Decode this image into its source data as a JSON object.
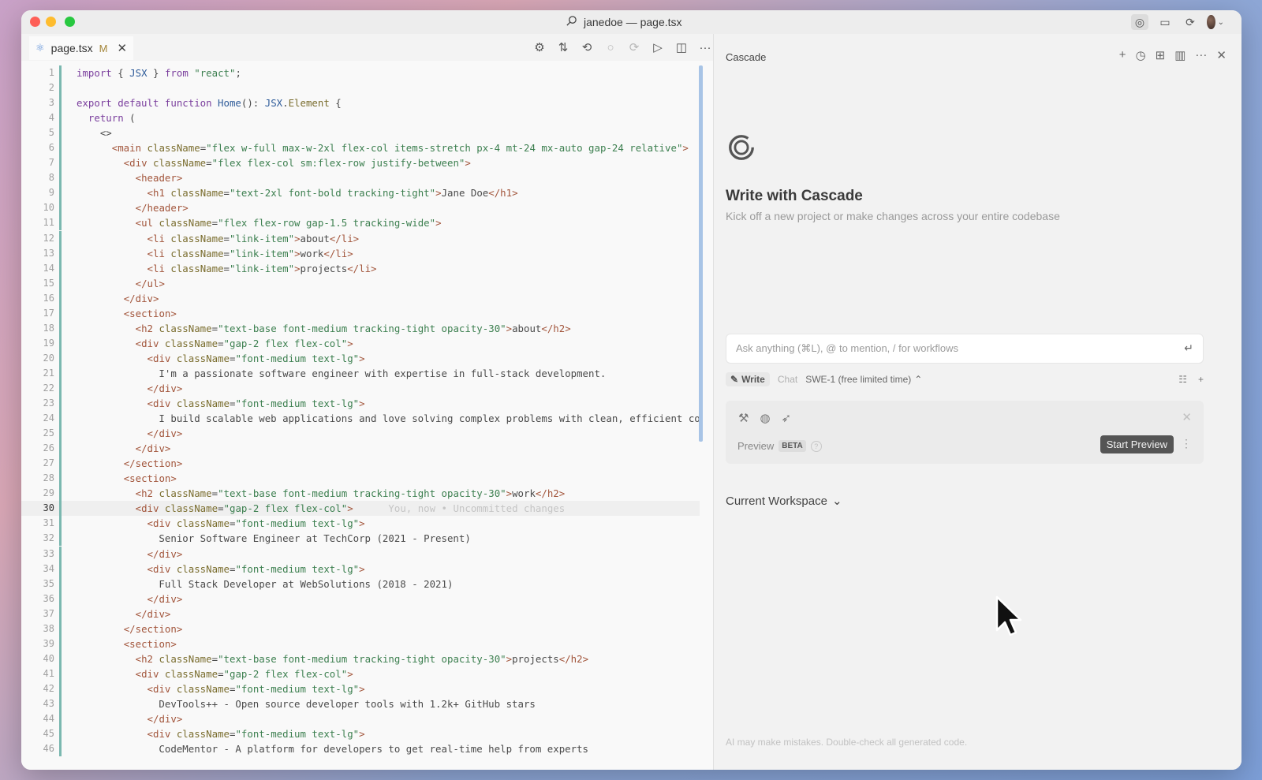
{
  "window": {
    "title": "janedoe — page.tsx"
  },
  "editor": {
    "tab": {
      "filename": "page.tsx",
      "status": "M"
    },
    "current_line": 30,
    "ghost_text": "You, now • Uncommitted changes",
    "lines": [
      [
        [
          "k",
          "import"
        ],
        [
          "t",
          " { "
        ],
        [
          "fn",
          "JSX"
        ],
        [
          "t",
          " } "
        ],
        [
          "k",
          "from"
        ],
        [
          "t",
          " "
        ],
        [
          "s",
          "\"react\""
        ],
        [
          "t",
          ";"
        ]
      ],
      [],
      [
        [
          "k",
          "export default function"
        ],
        [
          "t",
          " "
        ],
        [
          "fn",
          "Home"
        ],
        [
          "t",
          "(): "
        ],
        [
          "fn",
          "JSX"
        ],
        [
          "t",
          "."
        ],
        [
          "at",
          "Element"
        ],
        [
          "t",
          " {"
        ]
      ],
      [
        [
          "t",
          "  "
        ],
        [
          "k",
          "return"
        ],
        [
          "t",
          " ("
        ]
      ],
      [
        [
          "t",
          "    <>"
        ]
      ],
      [
        [
          "t",
          "      "
        ],
        [
          "tg",
          "<main"
        ],
        [
          "t",
          " "
        ],
        [
          "at",
          "className"
        ],
        [
          "t",
          "="
        ],
        [
          "s",
          "\"flex w-full max-w-2xl flex-col items-stretch px-4 mt-24 mx-auto gap-24 relative\""
        ],
        [
          "tg",
          ">"
        ]
      ],
      [
        [
          "t",
          "        "
        ],
        [
          "tg",
          "<div"
        ],
        [
          "t",
          " "
        ],
        [
          "at",
          "className"
        ],
        [
          "t",
          "="
        ],
        [
          "s",
          "\"flex flex-col sm:flex-row justify-between\""
        ],
        [
          "tg",
          ">"
        ]
      ],
      [
        [
          "t",
          "          "
        ],
        [
          "tg",
          "<header>"
        ]
      ],
      [
        [
          "t",
          "            "
        ],
        [
          "tg",
          "<h1"
        ],
        [
          "t",
          " "
        ],
        [
          "at",
          "className"
        ],
        [
          "t",
          "="
        ],
        [
          "s",
          "\"text-2xl font-bold tracking-tight\""
        ],
        [
          "tg",
          ">"
        ],
        [
          "t",
          "Jane Doe"
        ],
        [
          "tg",
          "</h1>"
        ]
      ],
      [
        [
          "t",
          "          "
        ],
        [
          "tg",
          "</header>"
        ]
      ],
      [
        [
          "t",
          "          "
        ],
        [
          "tg",
          "<ul"
        ],
        [
          "t",
          " "
        ],
        [
          "at",
          "className"
        ],
        [
          "t",
          "="
        ],
        [
          "s",
          "\"flex flex-row gap-1.5 tracking-wide\""
        ],
        [
          "tg",
          ">"
        ]
      ],
      [
        [
          "t",
          "            "
        ],
        [
          "tg",
          "<li"
        ],
        [
          "t",
          " "
        ],
        [
          "at",
          "className"
        ],
        [
          "t",
          "="
        ],
        [
          "s",
          "\"link-item\""
        ],
        [
          "tg",
          ">"
        ],
        [
          "t",
          "about"
        ],
        [
          "tg",
          "</li>"
        ]
      ],
      [
        [
          "t",
          "            "
        ],
        [
          "tg",
          "<li"
        ],
        [
          "t",
          " "
        ],
        [
          "at",
          "className"
        ],
        [
          "t",
          "="
        ],
        [
          "s",
          "\"link-item\""
        ],
        [
          "tg",
          ">"
        ],
        [
          "t",
          "work"
        ],
        [
          "tg",
          "</li>"
        ]
      ],
      [
        [
          "t",
          "            "
        ],
        [
          "tg",
          "<li"
        ],
        [
          "t",
          " "
        ],
        [
          "at",
          "className"
        ],
        [
          "t",
          "="
        ],
        [
          "s",
          "\"link-item\""
        ],
        [
          "tg",
          ">"
        ],
        [
          "t",
          "projects"
        ],
        [
          "tg",
          "</li>"
        ]
      ],
      [
        [
          "t",
          "          "
        ],
        [
          "tg",
          "</ul>"
        ]
      ],
      [
        [
          "t",
          "        "
        ],
        [
          "tg",
          "</div>"
        ]
      ],
      [
        [
          "t",
          "        "
        ],
        [
          "tg",
          "<section>"
        ]
      ],
      [
        [
          "t",
          "          "
        ],
        [
          "tg",
          "<h2"
        ],
        [
          "t",
          " "
        ],
        [
          "at",
          "className"
        ],
        [
          "t",
          "="
        ],
        [
          "s",
          "\"text-base font-medium tracking-tight opacity-30\""
        ],
        [
          "tg",
          ">"
        ],
        [
          "t",
          "about"
        ],
        [
          "tg",
          "</h2>"
        ]
      ],
      [
        [
          "t",
          "          "
        ],
        [
          "tg",
          "<div"
        ],
        [
          "t",
          " "
        ],
        [
          "at",
          "className"
        ],
        [
          "t",
          "="
        ],
        [
          "s",
          "\"gap-2 flex flex-col\""
        ],
        [
          "tg",
          ">"
        ]
      ],
      [
        [
          "t",
          "            "
        ],
        [
          "tg",
          "<div"
        ],
        [
          "t",
          " "
        ],
        [
          "at",
          "className"
        ],
        [
          "t",
          "="
        ],
        [
          "s",
          "\"font-medium text-lg\""
        ],
        [
          "tg",
          ">"
        ]
      ],
      [
        [
          "t",
          "              I'm a passionate software engineer with expertise in full-stack development."
        ]
      ],
      [
        [
          "t",
          "            "
        ],
        [
          "tg",
          "</div>"
        ]
      ],
      [
        [
          "t",
          "            "
        ],
        [
          "tg",
          "<div"
        ],
        [
          "t",
          " "
        ],
        [
          "at",
          "className"
        ],
        [
          "t",
          "="
        ],
        [
          "s",
          "\"font-medium text-lg\""
        ],
        [
          "tg",
          ">"
        ]
      ],
      [
        [
          "t",
          "              I build scalable web applications and love solving complex problems with clean, efficient co"
        ]
      ],
      [
        [
          "t",
          "            "
        ],
        [
          "tg",
          "</div>"
        ]
      ],
      [
        [
          "t",
          "          "
        ],
        [
          "tg",
          "</div>"
        ]
      ],
      [
        [
          "t",
          "        "
        ],
        [
          "tg",
          "</section>"
        ]
      ],
      [
        [
          "t",
          "        "
        ],
        [
          "tg",
          "<section>"
        ]
      ],
      [
        [
          "t",
          "          "
        ],
        [
          "tg",
          "<h2"
        ],
        [
          "t",
          " "
        ],
        [
          "at",
          "className"
        ],
        [
          "t",
          "="
        ],
        [
          "s",
          "\"text-base font-medium tracking-tight opacity-30\""
        ],
        [
          "tg",
          ">"
        ],
        [
          "t",
          "work"
        ],
        [
          "tg",
          "</h2>"
        ]
      ],
      [
        [
          "t",
          "          "
        ],
        [
          "tg",
          "<div"
        ],
        [
          "t",
          " "
        ],
        [
          "at",
          "className"
        ],
        [
          "t",
          "="
        ],
        [
          "s",
          "\"gap-2 flex flex-col\""
        ],
        [
          "tg",
          ">"
        ]
      ],
      [
        [
          "t",
          "            "
        ],
        [
          "tg",
          "<div"
        ],
        [
          "t",
          " "
        ],
        [
          "at",
          "className"
        ],
        [
          "t",
          "="
        ],
        [
          "s",
          "\"font-medium text-lg\""
        ],
        [
          "tg",
          ">"
        ]
      ],
      [
        [
          "t",
          "              Senior Software Engineer at TechCorp (2021 - Present)"
        ]
      ],
      [
        [
          "t",
          "            "
        ],
        [
          "tg",
          "</div>"
        ]
      ],
      [
        [
          "t",
          "            "
        ],
        [
          "tg",
          "<div"
        ],
        [
          "t",
          " "
        ],
        [
          "at",
          "className"
        ],
        [
          "t",
          "="
        ],
        [
          "s",
          "\"font-medium text-lg\""
        ],
        [
          "tg",
          ">"
        ]
      ],
      [
        [
          "t",
          "              Full Stack Developer at WebSolutions (2018 - 2021)"
        ]
      ],
      [
        [
          "t",
          "            "
        ],
        [
          "tg",
          "</div>"
        ]
      ],
      [
        [
          "t",
          "          "
        ],
        [
          "tg",
          "</div>"
        ]
      ],
      [
        [
          "t",
          "        "
        ],
        [
          "tg",
          "</section>"
        ]
      ],
      [
        [
          "t",
          "        "
        ],
        [
          "tg",
          "<section>"
        ]
      ],
      [
        [
          "t",
          "          "
        ],
        [
          "tg",
          "<h2"
        ],
        [
          "t",
          " "
        ],
        [
          "at",
          "className"
        ],
        [
          "t",
          "="
        ],
        [
          "s",
          "\"text-base font-medium tracking-tight opacity-30\""
        ],
        [
          "tg",
          ">"
        ],
        [
          "t",
          "projects"
        ],
        [
          "tg",
          "</h2>"
        ]
      ],
      [
        [
          "t",
          "          "
        ],
        [
          "tg",
          "<div"
        ],
        [
          "t",
          " "
        ],
        [
          "at",
          "className"
        ],
        [
          "t",
          "="
        ],
        [
          "s",
          "\"gap-2 flex flex-col\""
        ],
        [
          "tg",
          ">"
        ]
      ],
      [
        [
          "t",
          "            "
        ],
        [
          "tg",
          "<div"
        ],
        [
          "t",
          " "
        ],
        [
          "at",
          "className"
        ],
        [
          "t",
          "="
        ],
        [
          "s",
          "\"font-medium text-lg\""
        ],
        [
          "tg",
          ">"
        ]
      ],
      [
        [
          "t",
          "              DevTools++ - Open source developer tools with 1.2k+ GitHub stars"
        ]
      ],
      [
        [
          "t",
          "            "
        ],
        [
          "tg",
          "</div>"
        ]
      ],
      [
        [
          "t",
          "            "
        ],
        [
          "tg",
          "<div"
        ],
        [
          "t",
          " "
        ],
        [
          "at",
          "className"
        ],
        [
          "t",
          "="
        ],
        [
          "s",
          "\"font-medium text-lg\""
        ],
        [
          "tg",
          ">"
        ]
      ],
      [
        [
          "t",
          "              CodeMentor - A platform for developers to get real-time help from experts"
        ]
      ]
    ]
  },
  "cascade": {
    "header": "Cascade",
    "title": "Write with Cascade",
    "subtitle": "Kick off a new project or make changes across your entire codebase",
    "input_placeholder": "Ask anything (⌘L), @ to mention, / for workflows",
    "modes": {
      "write": "Write",
      "chat": "Chat"
    },
    "model": "SWE-1 (free limited time)",
    "preview": {
      "label": "Preview",
      "badge": "BETA",
      "help": "?",
      "start_button": "Start Preview"
    },
    "workspace": "Current Workspace",
    "disclaimer": "AI may make mistakes. Double-check all generated code."
  },
  "colors": {
    "accent": "#555555",
    "background": "#f2f2f2"
  }
}
